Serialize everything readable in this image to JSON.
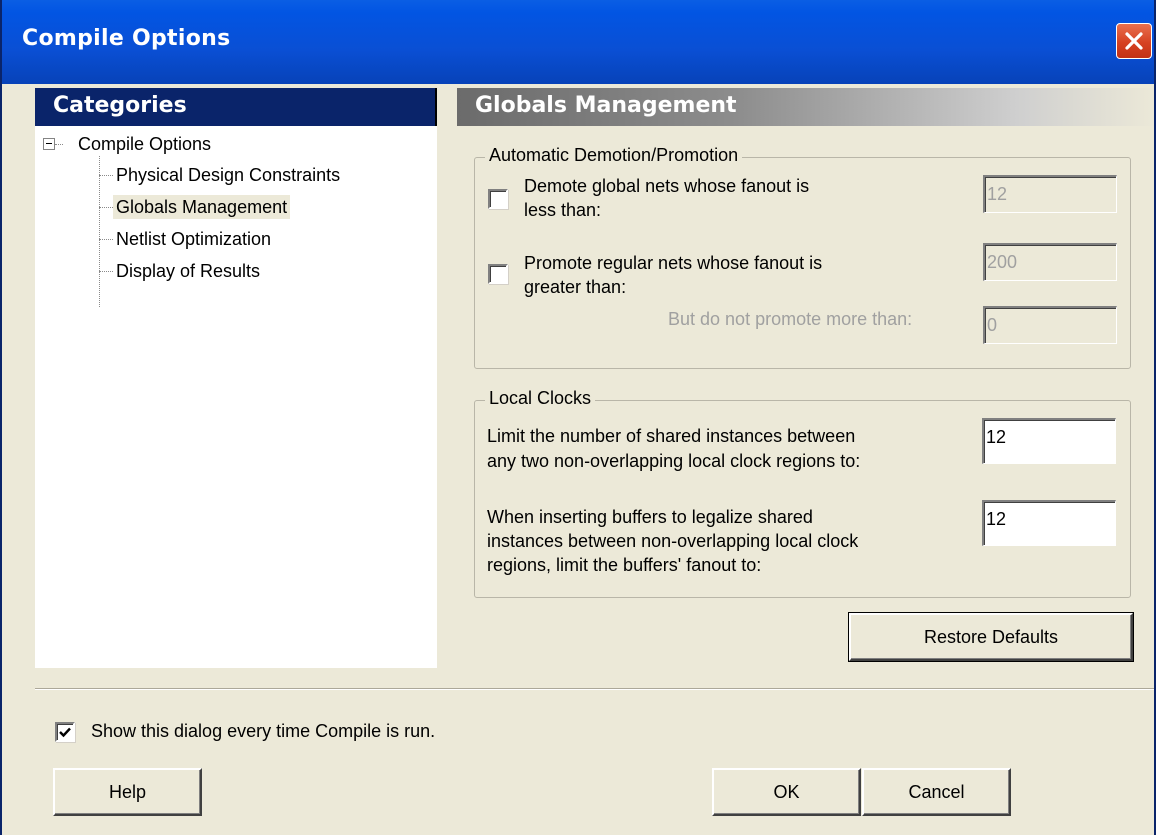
{
  "window": {
    "title": "Compile Options"
  },
  "categories": {
    "header": "Categories",
    "root": "Compile Options",
    "items": [
      {
        "label": "Physical Design Constraints"
      },
      {
        "label": "Globals Management",
        "selected": true
      },
      {
        "label": "Netlist Optimization"
      },
      {
        "label": "Display of Results"
      }
    ]
  },
  "section": {
    "title": "Globals Management"
  },
  "auto_group": {
    "legend": "Automatic Demotion/Promotion",
    "demote": {
      "label_line1": "Demote global nets whose fanout is",
      "label_line2": "less than:",
      "checked": false,
      "value": "12"
    },
    "promote": {
      "label_line1": "Promote regular nets whose fanout is",
      "label_line2": "greater than:",
      "checked": false,
      "value": "200"
    },
    "limit": {
      "label": "But do not promote more than:",
      "value": "0"
    }
  },
  "local_clocks": {
    "legend": "Local Clocks",
    "limit_shared": {
      "line1": "Limit the number of shared instances between",
      "line2": "any two non-overlapping local clock regions to:",
      "value": "12"
    },
    "buffers": {
      "line1": "When inserting buffers to legalize shared",
      "line2": "instances between non-overlapping local clock",
      "line3": "regions, limit the buffers' fanout to:",
      "value": "12"
    }
  },
  "buttons": {
    "restore": "Restore Defaults",
    "help": "Help",
    "ok": "OK",
    "cancel": "Cancel"
  },
  "show_dialog": {
    "label": "Show this dialog every time Compile is run.",
    "checked": true
  },
  "icons": {
    "close": "close-icon",
    "expander": "tree-collapse-icon",
    "check": "checkmark-icon"
  }
}
